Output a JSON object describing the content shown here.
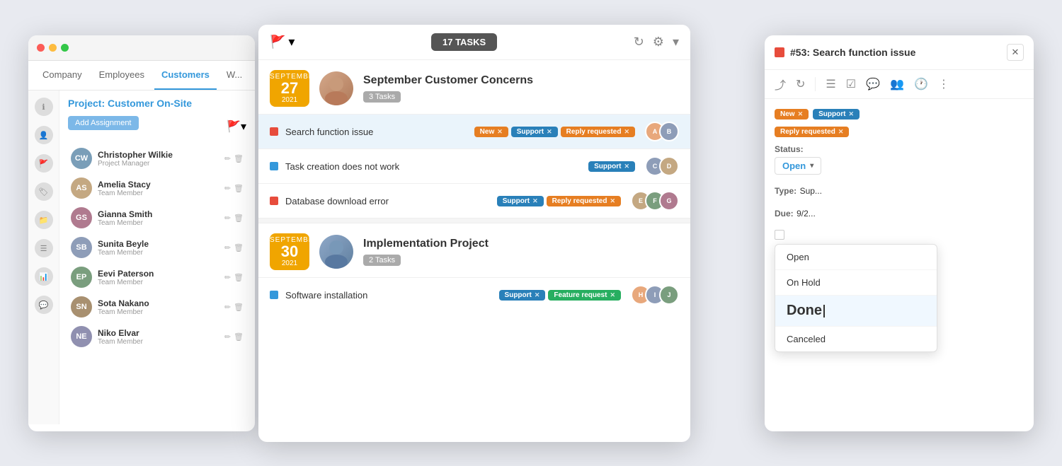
{
  "leftPanel": {
    "nav": {
      "items": [
        "Company",
        "Employees",
        "Customers",
        "W..."
      ],
      "active": "Customers"
    },
    "projectTitle": "Project: Customer On-Site",
    "addBtn": "Add Assignment",
    "members": [
      {
        "name": "Christopher Wilkie",
        "role": "Project Manager",
        "initials": "CW",
        "color": "#7a9eb8"
      },
      {
        "name": "Amelia Stacy",
        "role": "Team Member",
        "initials": "AS",
        "color": "#c4a882"
      },
      {
        "name": "Gianna Smith",
        "role": "Team Member",
        "initials": "GS",
        "color": "#b07a8f"
      },
      {
        "name": "Sunita Beyle",
        "role": "Team Member",
        "initials": "SB",
        "color": "#8e9db8"
      },
      {
        "name": "Eevi Paterson",
        "role": "Team Member",
        "initials": "EP",
        "color": "#7a9e7e"
      },
      {
        "name": "Sota Nakano",
        "role": "Team Member",
        "initials": "SN",
        "color": "#a89070"
      },
      {
        "name": "Niko Elvar",
        "role": "Team Member",
        "initials": "NE",
        "color": "#9090b0"
      }
    ]
  },
  "middlePanel": {
    "tasksCount": "17 TASKS",
    "groups": [
      {
        "month": "September",
        "day": "27",
        "year": "2021",
        "name": "September Customer Concerns",
        "taskCount": "3 Tasks",
        "tasks": [
          {
            "id": 1,
            "name": "Search function issue",
            "dotType": "red",
            "tags": [
              {
                "label": "New",
                "type": "new"
              },
              {
                "label": "Support",
                "type": "support"
              },
              {
                "label": "Reply requested",
                "type": "reply"
              }
            ],
            "selected": true
          },
          {
            "id": 2,
            "name": "Task creation does not work",
            "dotType": "blue",
            "tags": [
              {
                "label": "Support",
                "type": "support"
              }
            ],
            "selected": false
          },
          {
            "id": 3,
            "name": "Database download error",
            "dotType": "red",
            "tags": [
              {
                "label": "Support",
                "type": "support"
              },
              {
                "label": "Reply requested",
                "type": "reply"
              }
            ],
            "selected": false
          }
        ]
      },
      {
        "month": "September",
        "day": "30",
        "year": "2021",
        "name": "Implementation Project",
        "taskCount": "2 Tasks",
        "tasks": [
          {
            "id": 4,
            "name": "Software installation",
            "dotType": "blue",
            "tags": [
              {
                "label": "Support",
                "type": "support"
              },
              {
                "label": "Feature request",
                "type": "feature"
              }
            ],
            "selected": false
          }
        ]
      }
    ]
  },
  "rightPanel": {
    "title": "#53: Search function issue",
    "tags": [
      {
        "label": "New",
        "type": "new"
      },
      {
        "label": "Support",
        "type": "support"
      },
      {
        "label": "Reply requested",
        "type": "reply"
      }
    ],
    "statusLabel": "Status:",
    "statusValue": "Open",
    "typeLabel": "Type:",
    "typeValue": "Sup...",
    "dueLabel": "Due:",
    "dueValue": "9/2...",
    "dropdown": {
      "items": [
        "Open",
        "On Hold",
        "Done",
        "Canceled"
      ],
      "activeItem": "Done"
    }
  }
}
